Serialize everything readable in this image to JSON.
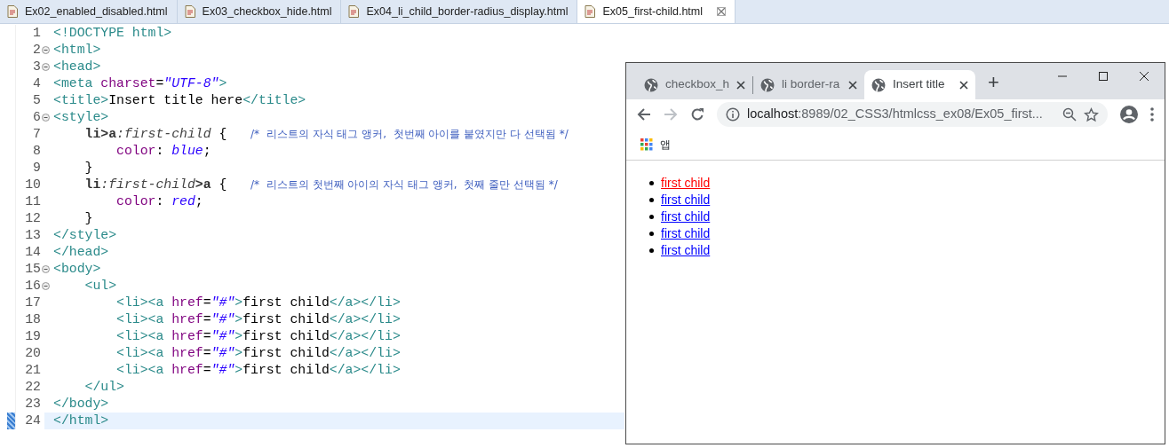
{
  "editor_tabs": [
    {
      "label": "Ex02_enabled_disabled.html",
      "selected": false
    },
    {
      "label": "Ex03_checkbox_hide.html",
      "selected": false
    },
    {
      "label": "Ex04_li_child_border-radius_display.html",
      "selected": false
    },
    {
      "label": "Ex05_first-child.html",
      "selected": true
    }
  ],
  "code_lines": [
    {
      "number": "1",
      "foldable": false,
      "selected": false,
      "tokens": [
        {
          "kind": "tag",
          "text": "<!DOCTYPE html>"
        }
      ]
    },
    {
      "number": "2",
      "foldable": true,
      "selected": false,
      "tokens": [
        {
          "kind": "tag",
          "text": "<html>"
        }
      ]
    },
    {
      "number": "3",
      "foldable": true,
      "selected": false,
      "tokens": [
        {
          "kind": "tag",
          "text": "<head>"
        }
      ]
    },
    {
      "number": "4",
      "foldable": false,
      "selected": false,
      "tokens": [
        {
          "kind": "tag",
          "text": "<meta "
        },
        {
          "kind": "attr",
          "text": "charset"
        },
        {
          "kind": "plain",
          "text": "="
        },
        {
          "kind": "string",
          "text": "\"UTF-8\""
        },
        {
          "kind": "tag",
          "text": ">"
        }
      ]
    },
    {
      "number": "5",
      "foldable": false,
      "selected": false,
      "tokens": [
        {
          "kind": "tag",
          "text": "<title>"
        },
        {
          "kind": "plain",
          "text": "Insert title here"
        },
        {
          "kind": "tag",
          "text": "</title>"
        }
      ]
    },
    {
      "number": "6",
      "foldable": true,
      "selected": false,
      "tokens": [
        {
          "kind": "tag",
          "text": "<style>"
        }
      ]
    },
    {
      "number": "7",
      "foldable": false,
      "selected": false,
      "tokens": [
        {
          "kind": "selector",
          "text": "    li>a"
        },
        {
          "kind": "pseudo",
          "text": ":first-child"
        },
        {
          "kind": "plain",
          "text": " {   "
        },
        {
          "kind": "comment",
          "text": "/*  리스트의 자식 태그 앵커,  첫번째 아이를 붙였지만 다 선택됨 */"
        }
      ]
    },
    {
      "number": "8",
      "foldable": false,
      "selected": false,
      "tokens": [
        {
          "kind": "property",
          "text": "        color"
        },
        {
          "kind": "plain",
          "text": ": "
        },
        {
          "kind": "value",
          "text": "blue"
        },
        {
          "kind": "plain",
          "text": ";"
        }
      ]
    },
    {
      "number": "9",
      "foldable": false,
      "selected": false,
      "tokens": [
        {
          "kind": "plain",
          "text": "    }"
        }
      ]
    },
    {
      "number": "10",
      "foldable": false,
      "selected": false,
      "tokens": [
        {
          "kind": "selector",
          "text": "    li"
        },
        {
          "kind": "pseudo",
          "text": ":first-child"
        },
        {
          "kind": "selector",
          "text": ">a"
        },
        {
          "kind": "plain",
          "text": " {   "
        },
        {
          "kind": "comment",
          "text": "/*  리스트의 첫번째 아이의 자식 태그 앵커,  첫째 줄만 선택됨 */"
        }
      ]
    },
    {
      "number": "11",
      "foldable": false,
      "selected": false,
      "tokens": [
        {
          "kind": "property",
          "text": "        color"
        },
        {
          "kind": "plain",
          "text": ": "
        },
        {
          "kind": "value",
          "text": "red"
        },
        {
          "kind": "plain",
          "text": ";"
        }
      ]
    },
    {
      "number": "12",
      "foldable": false,
      "selected": false,
      "tokens": [
        {
          "kind": "plain",
          "text": "    }"
        }
      ]
    },
    {
      "number": "13",
      "foldable": false,
      "selected": false,
      "tokens": [
        {
          "kind": "tag",
          "text": "</style>"
        }
      ]
    },
    {
      "number": "14",
      "foldable": false,
      "selected": false,
      "tokens": [
        {
          "kind": "tag",
          "text": "</head>"
        }
      ]
    },
    {
      "number": "15",
      "foldable": true,
      "selected": false,
      "tokens": [
        {
          "kind": "tag",
          "text": "<body>"
        }
      ]
    },
    {
      "number": "16",
      "foldable": true,
      "selected": false,
      "tokens": [
        {
          "kind": "tag",
          "text": "    <ul>"
        }
      ]
    },
    {
      "number": "17",
      "foldable": false,
      "selected": false,
      "tokens": [
        {
          "kind": "tag",
          "text": "        <li><a "
        },
        {
          "kind": "attr",
          "text": "href"
        },
        {
          "kind": "plain",
          "text": "="
        },
        {
          "kind": "string",
          "text": "\"#\""
        },
        {
          "kind": "tag",
          "text": ">"
        },
        {
          "kind": "plain",
          "text": "first child"
        },
        {
          "kind": "tag",
          "text": "</a></li>"
        }
      ]
    },
    {
      "number": "18",
      "foldable": false,
      "selected": false,
      "tokens": [
        {
          "kind": "tag",
          "text": "        <li><a "
        },
        {
          "kind": "attr",
          "text": "href"
        },
        {
          "kind": "plain",
          "text": "="
        },
        {
          "kind": "string",
          "text": "\"#\""
        },
        {
          "kind": "tag",
          "text": ">"
        },
        {
          "kind": "plain",
          "text": "first child"
        },
        {
          "kind": "tag",
          "text": "</a></li>"
        }
      ]
    },
    {
      "number": "19",
      "foldable": false,
      "selected": false,
      "tokens": [
        {
          "kind": "tag",
          "text": "        <li><a "
        },
        {
          "kind": "attr",
          "text": "href"
        },
        {
          "kind": "plain",
          "text": "="
        },
        {
          "kind": "string",
          "text": "\"#\""
        },
        {
          "kind": "tag",
          "text": ">"
        },
        {
          "kind": "plain",
          "text": "first child"
        },
        {
          "kind": "tag",
          "text": "</a></li>"
        }
      ]
    },
    {
      "number": "20",
      "foldable": false,
      "selected": false,
      "tokens": [
        {
          "kind": "tag",
          "text": "        <li><a "
        },
        {
          "kind": "attr",
          "text": "href"
        },
        {
          "kind": "plain",
          "text": "="
        },
        {
          "kind": "string",
          "text": "\"#\""
        },
        {
          "kind": "tag",
          "text": ">"
        },
        {
          "kind": "plain",
          "text": "first child"
        },
        {
          "kind": "tag",
          "text": "</a></li>"
        }
      ]
    },
    {
      "number": "21",
      "foldable": false,
      "selected": false,
      "tokens": [
        {
          "kind": "tag",
          "text": "        <li><a "
        },
        {
          "kind": "attr",
          "text": "href"
        },
        {
          "kind": "plain",
          "text": "="
        },
        {
          "kind": "string",
          "text": "\"#\""
        },
        {
          "kind": "tag",
          "text": ">"
        },
        {
          "kind": "plain",
          "text": "first child"
        },
        {
          "kind": "tag",
          "text": "</a></li>"
        }
      ]
    },
    {
      "number": "22",
      "foldable": false,
      "selected": false,
      "tokens": [
        {
          "kind": "tag",
          "text": "    </ul>"
        }
      ]
    },
    {
      "number": "23",
      "foldable": false,
      "selected": false,
      "tokens": [
        {
          "kind": "tag",
          "text": "</body>"
        }
      ]
    },
    {
      "number": "24",
      "foldable": false,
      "selected": true,
      "tokens": [
        {
          "kind": "tag",
          "text": "</html>"
        }
      ]
    }
  ],
  "browser": {
    "tabs": [
      {
        "label": "checkbox_h",
        "selected": false
      },
      {
        "label": "li border-ra",
        "selected": false
      },
      {
        "label": "Insert title",
        "selected": true
      }
    ],
    "new_tab": "+",
    "address": {
      "host": "localhost",
      "path": ":8989/02_CSS3/htmlcss_ex08/Ex05_first..."
    },
    "bookmarks": [
      {
        "label": "앱"
      }
    ],
    "links": [
      {
        "text": "first child",
        "color": "#ff0000"
      },
      {
        "text": "first child",
        "color": "#0000ff"
      },
      {
        "text": "first child",
        "color": "#0000ff"
      },
      {
        "text": "first child",
        "color": "#0000ff"
      },
      {
        "text": "first child",
        "color": "#0000ff"
      }
    ]
  }
}
